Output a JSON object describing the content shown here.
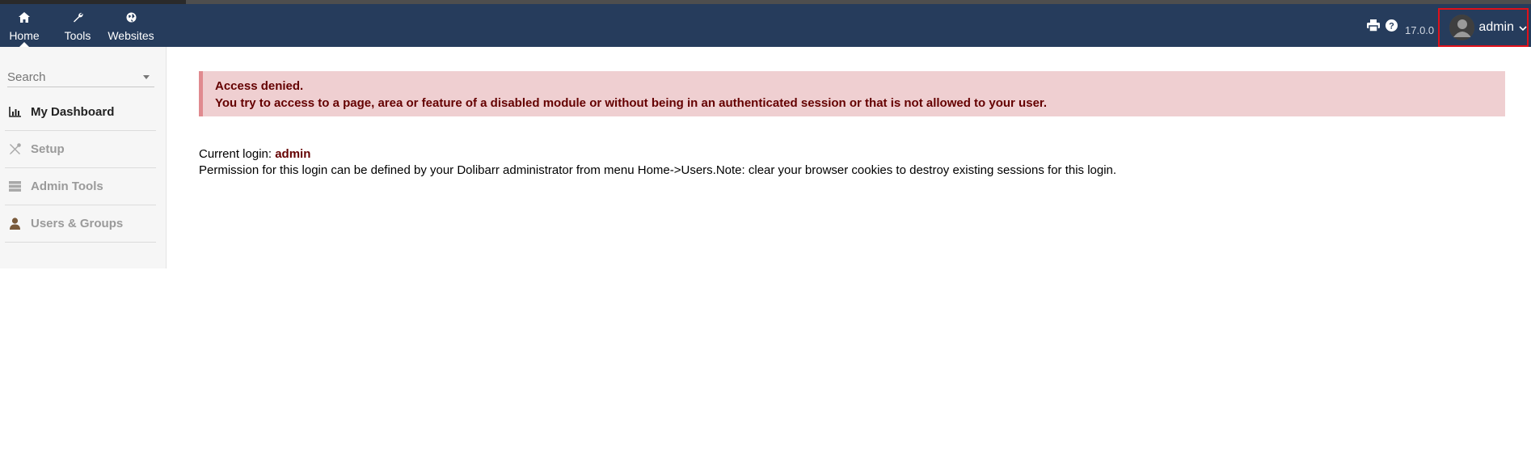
{
  "topnav": {
    "items": [
      {
        "label": "Home",
        "icon": "home-icon",
        "active": true
      },
      {
        "label": "Tools",
        "icon": "wrench-icon",
        "active": false
      },
      {
        "label": "Websites",
        "icon": "globe-icon",
        "active": false
      }
    ],
    "version": "17.0.0",
    "user": {
      "name": "admin"
    }
  },
  "sidebar": {
    "search_placeholder": "Search",
    "items": [
      {
        "label": "My Dashboard",
        "icon": "chart-icon",
        "active": true
      },
      {
        "label": "Setup",
        "icon": "tools-icon",
        "active": false
      },
      {
        "label": "Admin Tools",
        "icon": "server-icon",
        "active": false
      },
      {
        "label": "Users & Groups",
        "icon": "user-icon",
        "active": false
      }
    ]
  },
  "alert": {
    "title": "Access denied.",
    "message": "You try to access to a page, area or feature of a disabled module or without being in an authenticated session or that is not allowed to your user."
  },
  "info": {
    "login_label": "Current login: ",
    "login_value": "admin",
    "permission_text": "Permission for this login can be defined by your Dolibarr administrator from menu Home->Users.Note: clear your browser cookies to destroy existing sessions for this login."
  },
  "colors": {
    "navbar": "#263c5c",
    "alert_bg": "#efcfd1",
    "alert_text": "#640000",
    "highlight_border": "#e0111a"
  }
}
